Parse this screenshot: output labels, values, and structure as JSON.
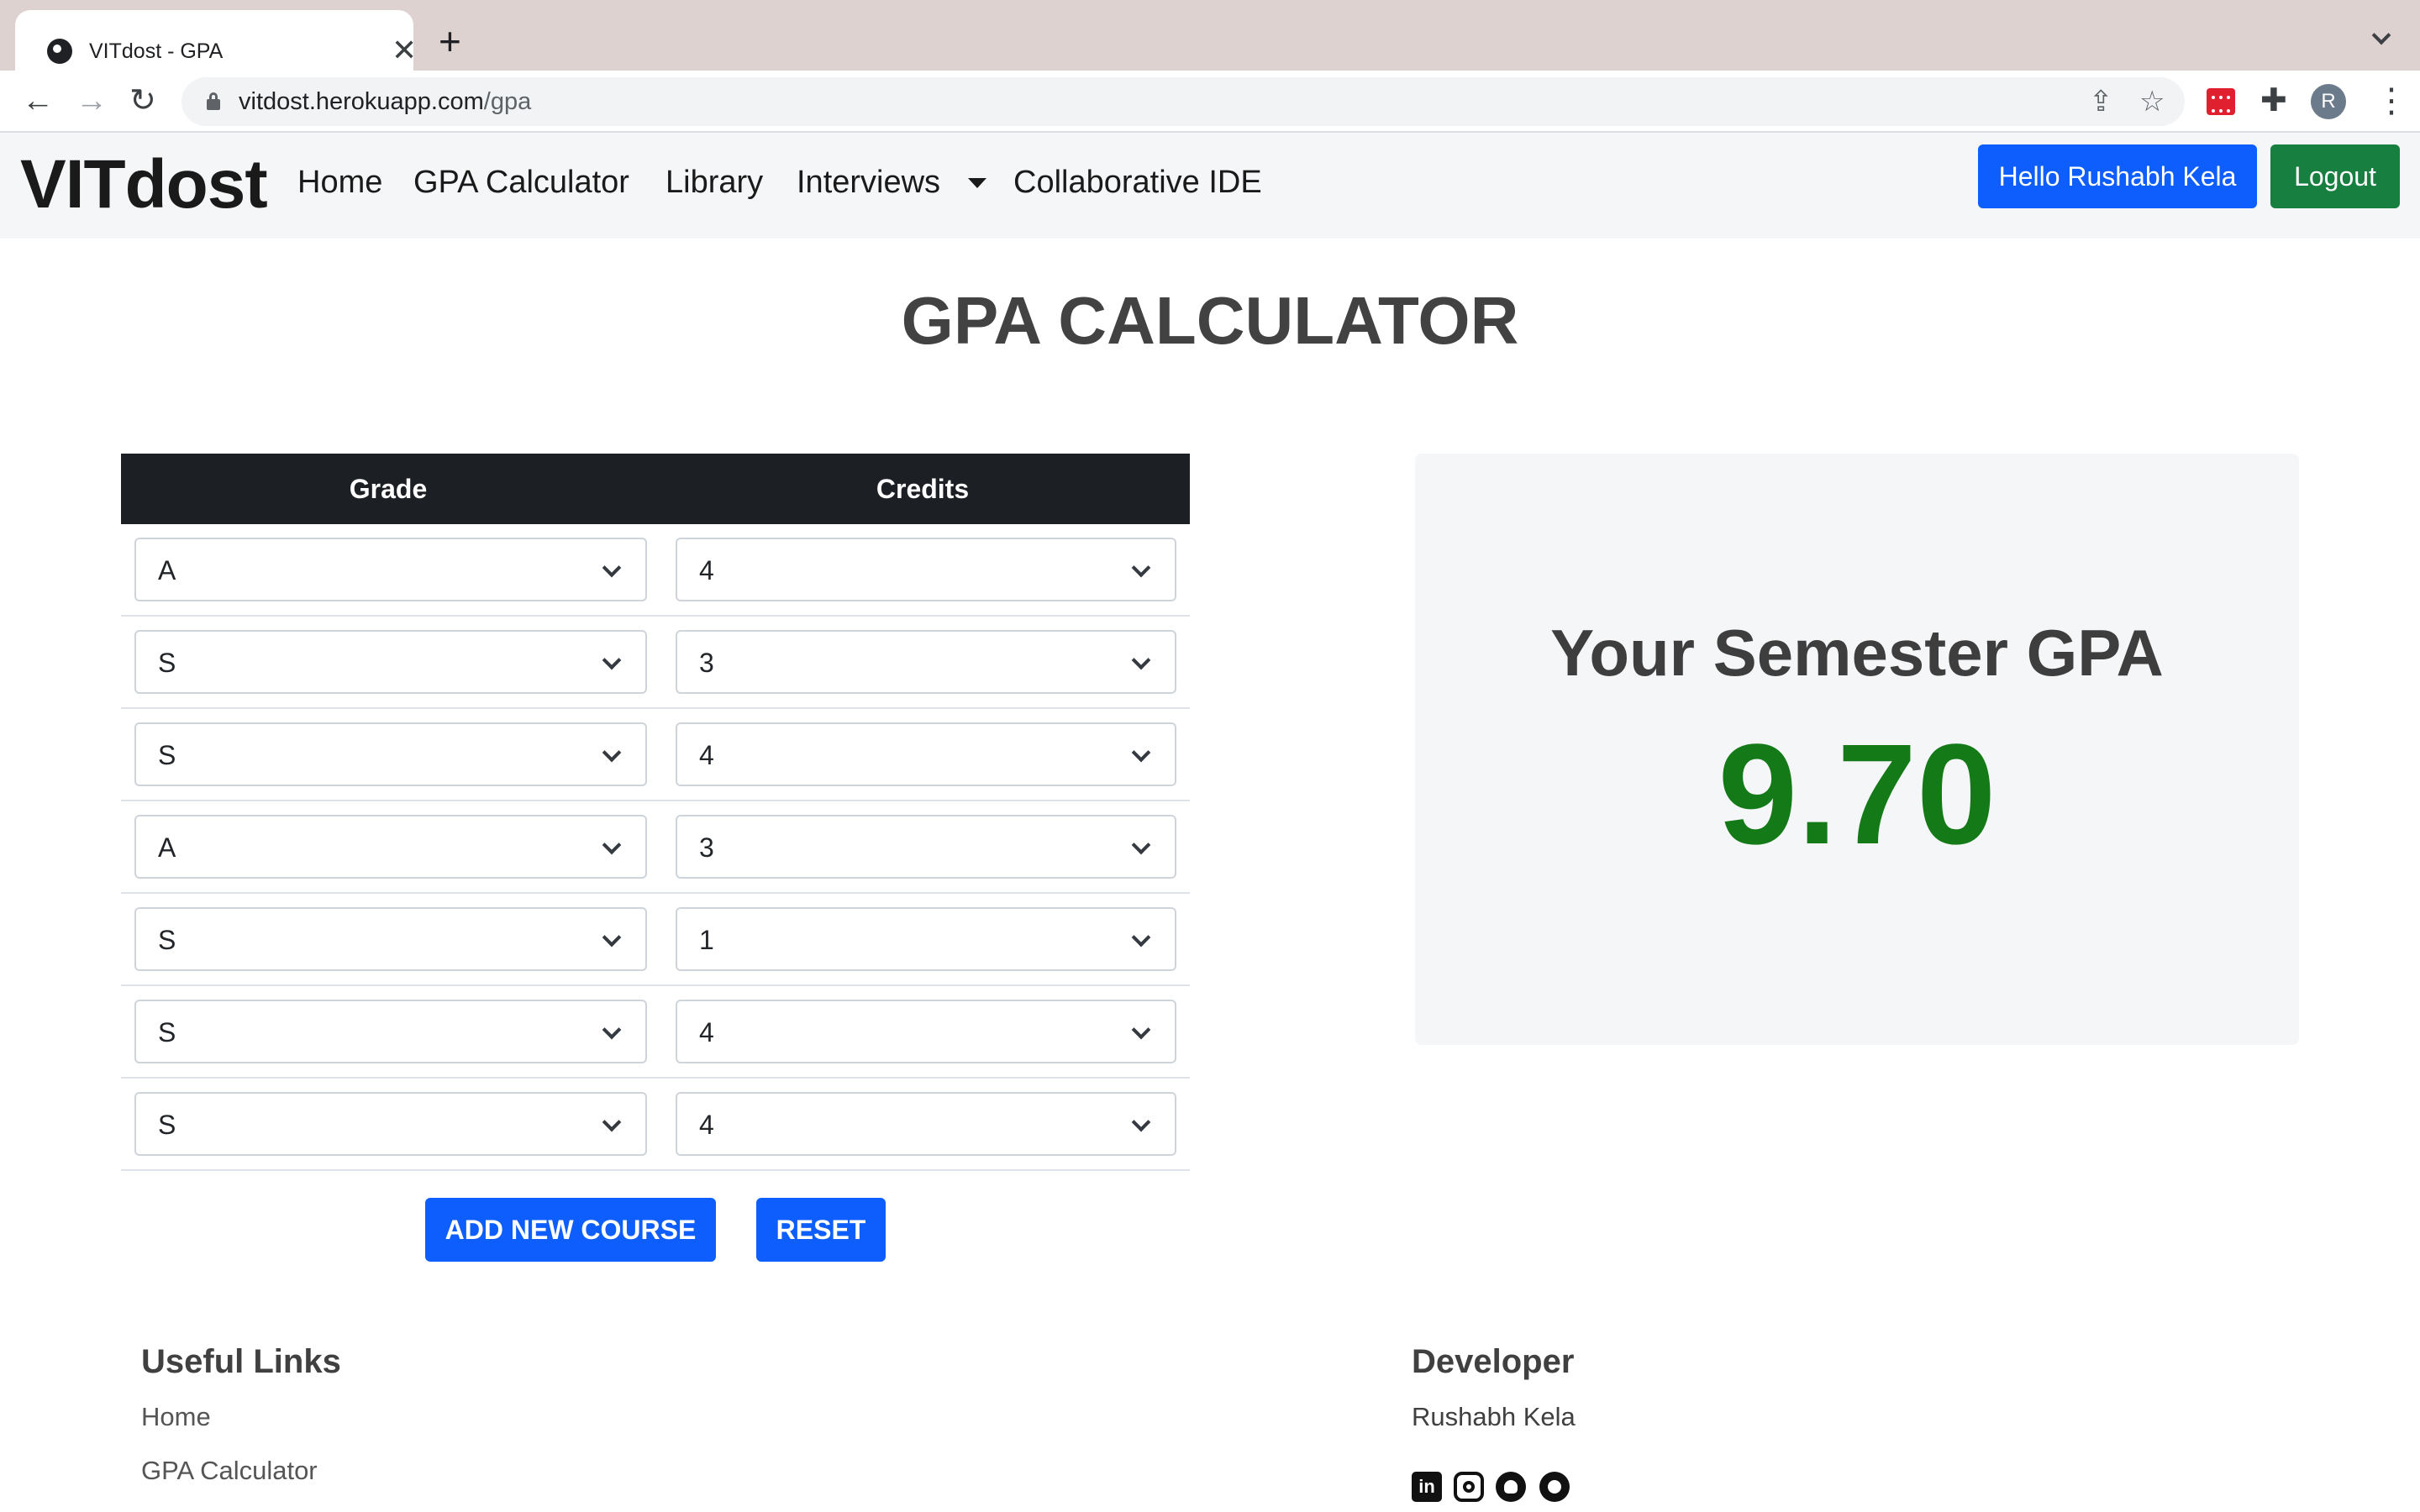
{
  "browser": {
    "tab_title": "VITdost - GPA",
    "tab_close": "✕",
    "new_tab": "+",
    "url_host": "vitdost.herokuapp.com",
    "url_path": "/gpa",
    "back_glyph": "←",
    "forward_glyph": "→",
    "reload_glyph": "↻",
    "share_glyph": "⇪",
    "star_glyph": "☆",
    "puzzle_glyph": "✚",
    "menu_glyph": "⋮",
    "profile_initial": "R"
  },
  "site_nav": {
    "brand": "VITdost",
    "links": [
      "Home",
      "GPA Calculator",
      "Library",
      "Interviews",
      "Collaborative IDE"
    ],
    "greeting_button": "Hello Rushabh Kela",
    "logout_button": "Logout"
  },
  "page": {
    "title": "GPA CALCULATOR"
  },
  "gpa_table": {
    "headers": {
      "grade": "Grade",
      "credits": "Credits"
    },
    "rows": [
      {
        "grade": "A",
        "credits": "4"
      },
      {
        "grade": "S",
        "credits": "3"
      },
      {
        "grade": "S",
        "credits": "4"
      },
      {
        "grade": "A",
        "credits": "3"
      },
      {
        "grade": "S",
        "credits": "1"
      },
      {
        "grade": "S",
        "credits": "4"
      },
      {
        "grade": "S",
        "credits": "4"
      }
    ],
    "add_button": "ADD NEW COURSE",
    "reset_button": "RESET"
  },
  "result": {
    "label": "Your Semester GPA",
    "value": "9.70",
    "value_color": "#137a17"
  },
  "footer": {
    "useful_links_heading": "Useful Links",
    "useful_links": [
      "Home",
      "GPA Calculator"
    ],
    "developer_heading": "Developer",
    "developer_name": "Rushabh Kela",
    "social_icons": [
      "linkedin-icon",
      "instagram-icon",
      "github-icon",
      "chrome-icon"
    ],
    "linkedin_glyph": "in"
  },
  "colors": {
    "primary": "#0d5efc",
    "success": "#177f3f",
    "table_header": "#1c1f23"
  }
}
